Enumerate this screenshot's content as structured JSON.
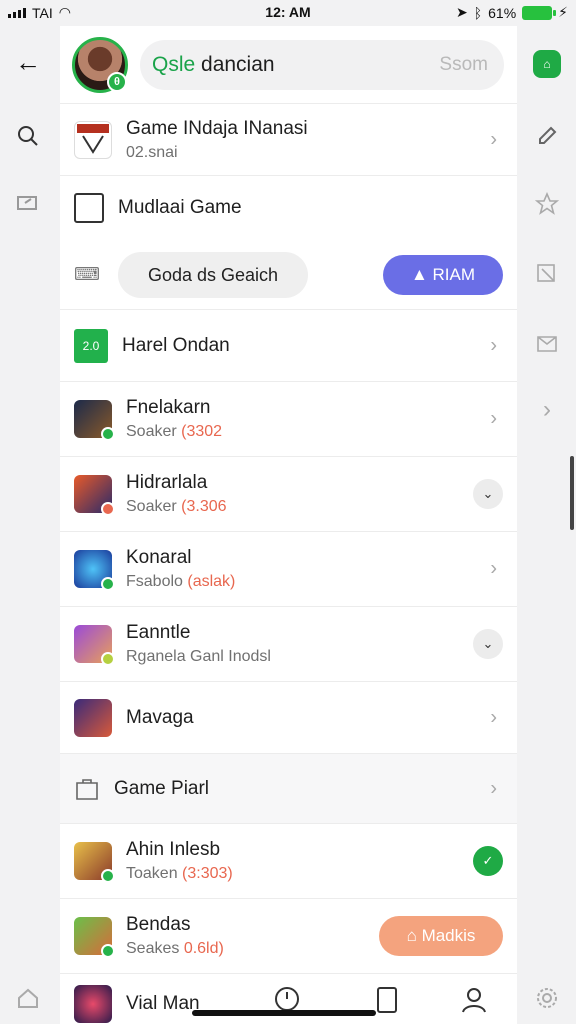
{
  "status": {
    "carrier": "TAI",
    "time": "12: AM",
    "battery": "61%"
  },
  "header": {
    "title_accent": "Qsle",
    "title_rest": " dancian",
    "search_placeholder": "Ssom"
  },
  "rows": [
    {
      "title": "Game INdaja INanasi",
      "sub": "02.snai"
    },
    {
      "title": "Mudlaai Game"
    },
    {
      "tag": "2.0",
      "title": "Harel Ondan"
    },
    {
      "title": "Fnelakarn",
      "sub_a": "Soaker ",
      "sub_b": "(3302"
    },
    {
      "title": "Hidrarlala",
      "sub_a": "Soaker ",
      "sub_b": "(3.306"
    },
    {
      "title": "Konaral",
      "sub_a": "Fsabolo ",
      "sub_b": "(aslak)"
    },
    {
      "title": "Eanntle",
      "sub_a": "Rganela Ganl Inodsl",
      "sub_b": ""
    },
    {
      "title": "Mavaga"
    },
    {
      "title": "Game Piarl"
    },
    {
      "title": "Ahin Inlesb",
      "sub_a": "Toaken ",
      "sub_b": "(3:303)"
    },
    {
      "title": "Bendas",
      "sub_a": "Seakes ",
      "sub_b": "0.6ld)"
    },
    {
      "title": "Vial Man",
      "sub_a": "",
      "sub_b": ""
    }
  ],
  "actions": {
    "pill_gray": "Goda ds Geaich",
    "pill_blue": "RIAM",
    "pill_orange": "Madkis"
  },
  "icons": [
    "back-arrow-icon",
    "search-icon",
    "tag-icon",
    "pencil-icon",
    "star-icon",
    "edit-icon",
    "inbox-icon",
    "chevron-right-icon",
    "home-icon",
    "clock-icon",
    "phone-icon",
    "user-icon",
    "gear-icon"
  ],
  "colors": {
    "green": "#1faa45",
    "blue": "#6a6ee6",
    "orange": "#f4a37e",
    "accent_red": "#e8674f"
  }
}
